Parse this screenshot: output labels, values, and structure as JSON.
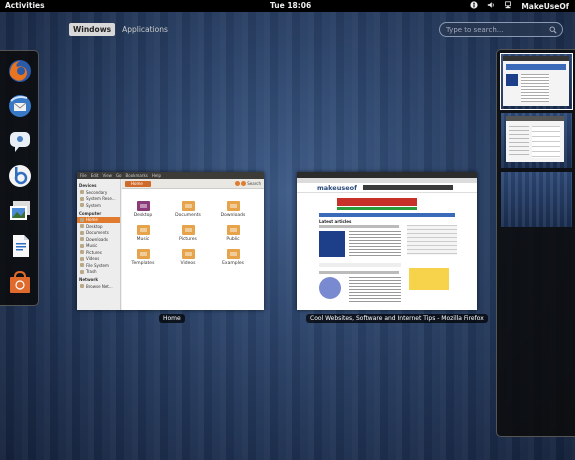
{
  "top_panel": {
    "activities": "Activities",
    "clock": "Tue 18:06",
    "user": "MakeUseOf",
    "indicators": [
      "accessibility-icon",
      "volume-icon",
      "network-icon"
    ]
  },
  "view_toggle": {
    "windows": "Windows",
    "applications": "Applications",
    "active": "windows"
  },
  "search": {
    "placeholder": "Type to search..."
  },
  "dash": {
    "apps": [
      "firefox-icon",
      "thunderbird-icon",
      "empathy-icon",
      "banshee-icon",
      "shotwell-icon",
      "libreoffice-writer-icon",
      "ubuntu-software-center-icon"
    ]
  },
  "windows": {
    "home": {
      "label": "Home",
      "menu": [
        "File",
        "Edit",
        "View",
        "Go",
        "Bookmarks",
        "Help"
      ],
      "path": "Home",
      "search_label": "Search",
      "sidebar": {
        "devices_header": "Devices",
        "devices": [
          "Secondary",
          "System Rese...",
          "System"
        ],
        "computer_header": "Computer",
        "computer": [
          "Home",
          "Desktop",
          "Documents",
          "Downloads",
          "Music",
          "Pictures",
          "Videos",
          "File System",
          "Trash"
        ],
        "network_header": "Network",
        "network": [
          "Browse Net..."
        ]
      },
      "folders": [
        "Desktop",
        "Documents",
        "Downloads",
        "Music",
        "Pictures",
        "Public",
        "Templates",
        "Videos",
        "Examples"
      ]
    },
    "firefox": {
      "label": "Cool Websites, Software and Internet Tips - Mozilla Firefox",
      "site_logo": "makeuseof",
      "latest_articles": "Latest articles"
    }
  },
  "colors": {
    "accent": "#e07a2d",
    "panel": "#000000",
    "desktop": "#24395c"
  }
}
